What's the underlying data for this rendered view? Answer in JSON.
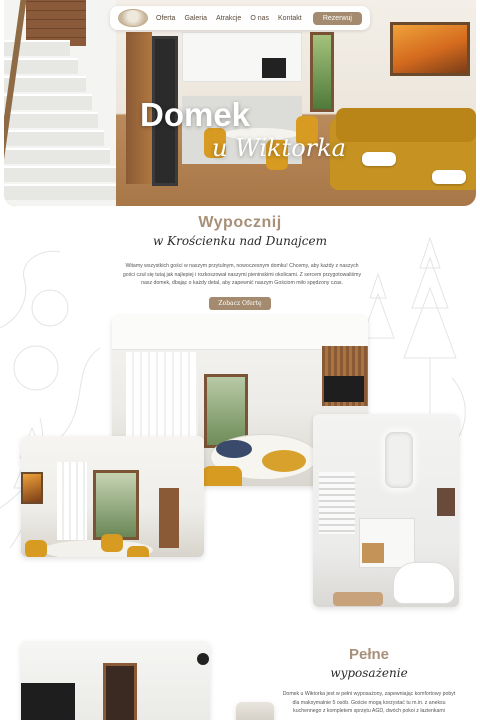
{
  "nav": {
    "links": [
      "Oferta",
      "Galeria",
      "Atrakcje",
      "O nas",
      "Kontakt"
    ],
    "cta": "Rezerwuj"
  },
  "hero": {
    "title": "Domek",
    "subtitle": "u Wiktorka"
  },
  "intro": {
    "heading": "Wypocznij",
    "subheading": "w Krościenku nad Dunajcem",
    "text": "Witamy wszystkich gości w naszym przytulnym, nowoczesnym domku! Chcemy, aby każdy z naszych gości czuł się tutaj jak najlepiej i rozkoszował naszymi pieninskimi okolicami. Z sercem przygotowaliśmy nasz domek, dbając o każdy detal, aby zapewnić naszym Gościom miło spędzony czas.",
    "button": "Zobacz Ofertę"
  },
  "equipment": {
    "heading": "Pełne",
    "subheading": "wyposażenie",
    "text": "Domek u Wiktorka jest w pełni wyposażony, zapewniając komfortowy pobyt dla maksymalnie 5 osób. Goście mogą korzystać tu m.in. z aneksu kuchennego z kompletem sprzętu AGD, dwóch pokoi z łazienkami"
  },
  "icons": {
    "logo": "house-logo-icon"
  },
  "colors": {
    "accent": "#a48a6e",
    "heading": "#a89078",
    "mustard": "#d79b22"
  }
}
